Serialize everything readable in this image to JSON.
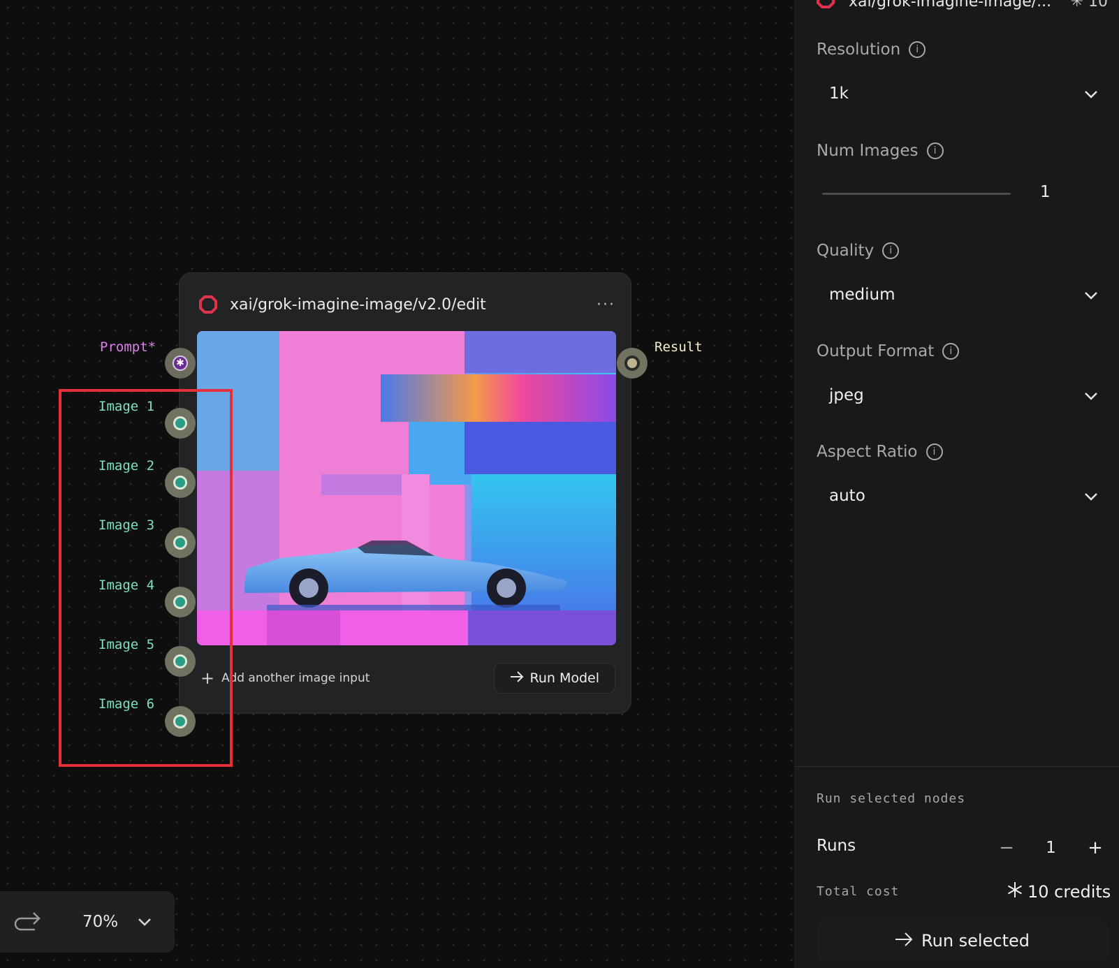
{
  "node": {
    "title": "xai/grok-imagine-image/v2.0/edit",
    "menu": "···",
    "add_input_label": "Add another image input",
    "run_model_label": "Run Model"
  },
  "ports": {
    "prompt_label": "Prompt*",
    "result_label": "Result",
    "image_labels": [
      "Image 1",
      "Image 2",
      "Image 3",
      "Image 4",
      "Image 5",
      "Image 6"
    ]
  },
  "zoom": {
    "value": "70%"
  },
  "panel": {
    "header_title": "xai/grok-imagine-image/...",
    "header_cost": "✳ 10",
    "fields": {
      "resolution": {
        "label": "Resolution",
        "value": "1k"
      },
      "num_images": {
        "label": "Num Images",
        "value": "1"
      },
      "quality": {
        "label": "Quality",
        "value": "medium"
      },
      "output_format": {
        "label": "Output Format",
        "value": "jpeg"
      },
      "aspect_ratio": {
        "label": "Aspect Ratio",
        "value": "auto"
      }
    },
    "run_section": {
      "title": "Run selected nodes",
      "runs_label": "Runs",
      "runs_value": "1",
      "minus": "−",
      "plus": "+",
      "total_label": "Total cost",
      "credits": "10 credits",
      "run_selected_label": "Run selected"
    }
  },
  "colors": {
    "accent_red": "#e5303a",
    "node_icon": "#e0324a",
    "image_port": "#2a9d86",
    "prompt_label": "#e07ef0",
    "image_label": "#7ee0c0",
    "result_label": "#f3ecc4"
  }
}
